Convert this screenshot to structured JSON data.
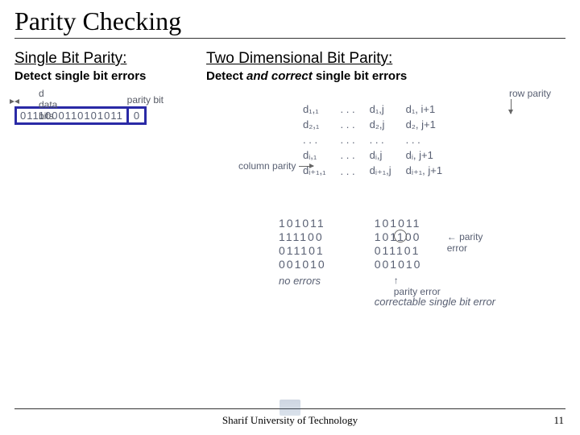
{
  "title": "Parity Checking",
  "left": {
    "heading": "Single Bit Parity:",
    "desc": "Detect single bit errors",
    "fig": {
      "data_label": "d data bits",
      "parity_label": "parity bit",
      "data_bits": "0111000110101011",
      "parity_bit": "0"
    }
  },
  "right": {
    "heading": "Two Dimensional Bit Parity:",
    "desc_pre": "Detect ",
    "desc_em": "and correct",
    "desc_post": " single bit errors",
    "row_parity_label": "row parity",
    "col_parity_label": "column parity",
    "matrix": {
      "r1": [
        "d₁,₁",
        ". . .",
        "d₁,j",
        "d₁, i+1"
      ],
      "r2": [
        "d₂,₁",
        ". . .",
        "d₂,j",
        "d₂, j+1"
      ],
      "r3": [
        ". . .",
        ". . .",
        ". . .",
        ". . ."
      ],
      "r4": [
        "dᵢ,₁",
        ". . .",
        "dᵢ,j",
        "dᵢ, j+1"
      ],
      "r5": [
        "dᵢ₊₁,₁",
        ". . .",
        "dᵢ₊₁,j",
        "dᵢ₊₁, j+1"
      ]
    },
    "examples": {
      "left": {
        "rows": [
          "101011",
          "111100",
          "011101",
          "001010"
        ],
        "cap": "no errors"
      },
      "right": {
        "rows": [
          "101011",
          "101100",
          "011101",
          "001010"
        ],
        "side_label": "parity error",
        "bot_label": "parity error",
        "cap": "correctable single bit error"
      }
    }
  },
  "footer": "Sharif University of Technology",
  "page": "11"
}
